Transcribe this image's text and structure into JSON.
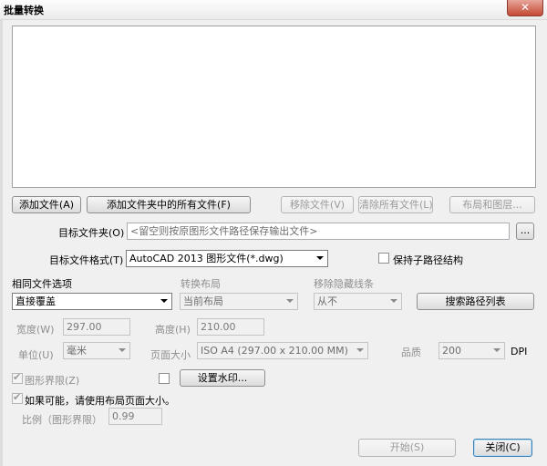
{
  "window": {
    "title": "批量转换",
    "close_glyph": "✕"
  },
  "toolbar": {
    "add_file": "添加文件(A)",
    "add_folder_files": "添加文件夹中的所有文件(F)",
    "remove_file": "移除文件(V)",
    "clear_all": "清除所有文件(L)",
    "layouts": "布局和图层..."
  },
  "target_folder": {
    "label": "目标文件夹(O)",
    "placeholder": "<留空则按原图形文件路径保存输出文件>",
    "browse": "..."
  },
  "target_format": {
    "label": "目标文件格式(T)",
    "value": "AutoCAD 2013 图形文件(*.dwg)",
    "keep_subpath_label": "保持子路径结构"
  },
  "options": {
    "same_file_label": "相同文件选项",
    "same_file_value": "直接覆盖",
    "convert_layout_label": "转换布局",
    "convert_layout_value": "当前布局",
    "remove_hidden_label": "移除隐藏线条",
    "remove_hidden_value": "从不",
    "search_path_button": "搜索路径列表"
  },
  "page": {
    "width_label": "宽度(W)",
    "width_value": "297.00",
    "height_label": "高度(H)",
    "height_value": "210.00",
    "unit_label": "单位(U)",
    "unit_value": "毫米",
    "page_size_label": "页面大小",
    "page_size_value": "ISO A4 (297.00 x 210.00 MM)",
    "quality_label": "品质",
    "quality_value": "200",
    "dpi_label": "DPI"
  },
  "extents": {
    "drawing_limits_label": "图形界限(Z)",
    "watermark_button": "设置水印...",
    "use_layout_size_label": "如果可能，请使用布局页面大小。",
    "scale_label": "比例（图形界限）",
    "scale_value": "0.99"
  },
  "footer": {
    "start": "开始(S)",
    "close": "关闭(C)"
  }
}
